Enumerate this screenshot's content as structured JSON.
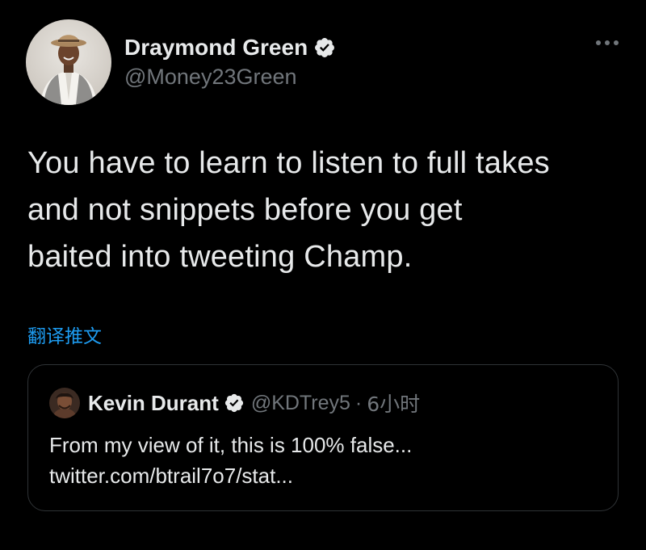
{
  "author": {
    "display_name": "Draymond Green",
    "handle": "@Money23Green",
    "verified_icon": "verified-badge-icon"
  },
  "tweet": {
    "text_lines": [
      "You have to learn to listen to full takes",
      "and not snippets before you get",
      "baited into tweeting Champ."
    ],
    "translate_label": "翻译推文"
  },
  "quoted_tweet": {
    "display_name": "Kevin Durant",
    "handle": "@KDTrey5",
    "separator": "·",
    "time": "6小时",
    "text_lines": [
      "From my view of it, this is 100% false...",
      "twitter.com/btrail7o7/stat..."
    ]
  },
  "colors": {
    "background": "#000000",
    "primary_text": "#e7e9ea",
    "secondary_text": "#71767b",
    "link": "#1d9bf0",
    "border": "#2f3336",
    "verified_badge": "#e7e9ea"
  }
}
